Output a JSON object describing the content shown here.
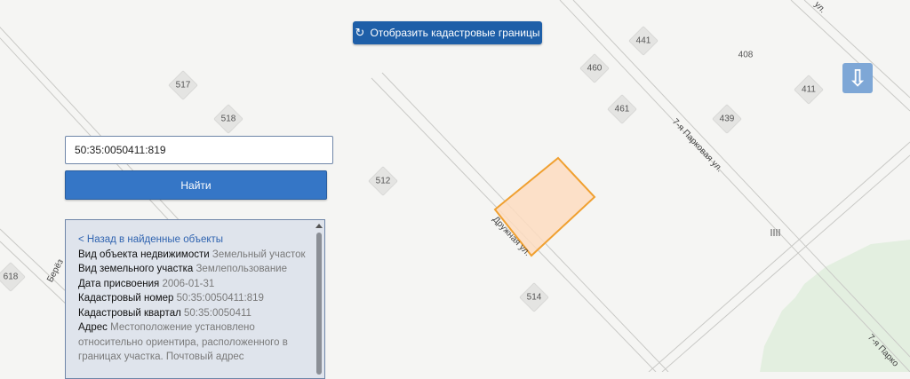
{
  "toolbar": {
    "cadastral_button_label": "Отобразить кадастровые границы",
    "cadastral_icon": "refresh-icon",
    "arrow_icon": "arrow-down-icon"
  },
  "search": {
    "value": "50:35:0050411:819",
    "find_label": "Найти"
  },
  "info": {
    "back_label": "< Назад в найденные объекты",
    "fields": [
      {
        "key": "Вид объекта недвижимости",
        "value": "Земельный участок"
      },
      {
        "key": "Вид земельного участка",
        "value": "Землепользование"
      },
      {
        "key": "Дата присвоения",
        "value": "2006-01-31"
      },
      {
        "key": "Кадастровый номер",
        "value": "50:35:0050411:819"
      },
      {
        "key": "Кадастровый квартал",
        "value": "50:35:0050411"
      },
      {
        "key": "Адрес",
        "value": "Местоположение установлено относительно ориентира, расположенного в границах участка. Почтовый адрес"
      }
    ]
  },
  "map": {
    "house_numbers": [
      "517",
      "518",
      "512",
      "514",
      "618",
      "441",
      "460",
      "461",
      "439",
      "411",
      "408"
    ],
    "streets": [
      "7-я Парковая ул.",
      "Дружная ул.",
      "Берёз",
      "7-я Парко",
      "ул."
    ],
    "colors": {
      "parcel_fill": "#fddcc0",
      "parcel_stroke": "#f0a030",
      "park": "#e3efe0"
    }
  }
}
